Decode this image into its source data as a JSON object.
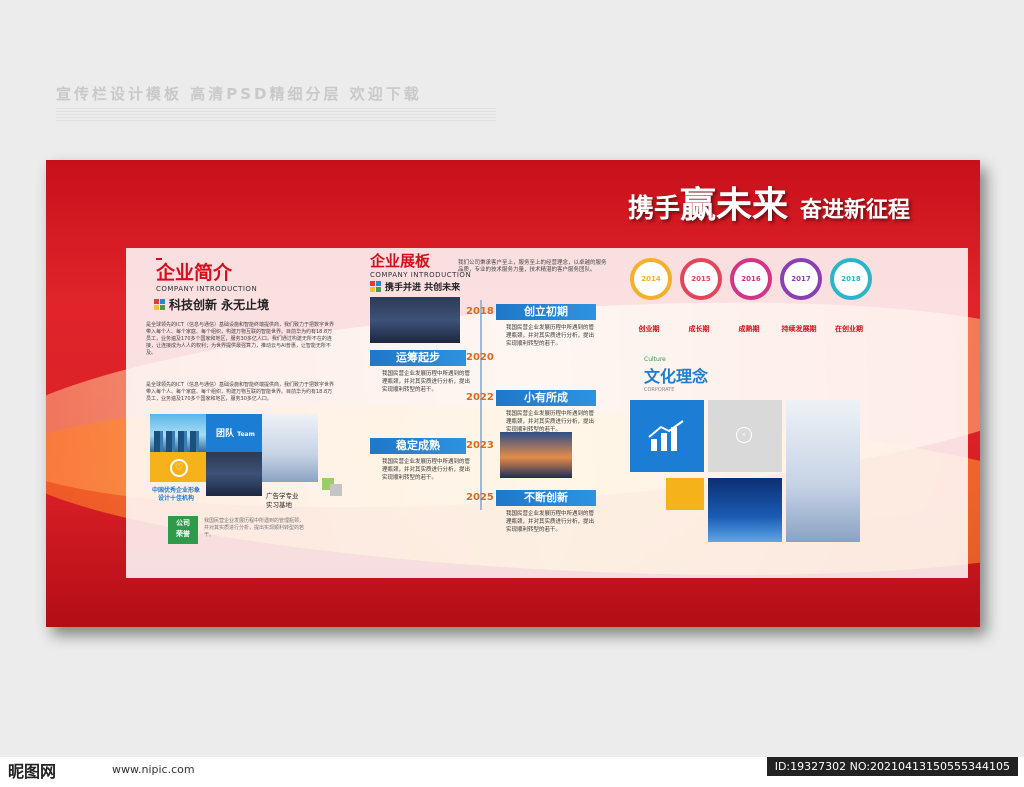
{
  "header": {
    "banner_text": "宣传栏设计模板 高清PSD精细分层 欢迎下载"
  },
  "board": {
    "slogan_part1": "携手",
    "slogan_part2": "赢未来",
    "slogan_part3": "奋进新征程"
  },
  "intro": {
    "title": "企业简介",
    "subtitle": "COMPANY INTRODUCTION",
    "tagline": "科技创新 永无止境",
    "paragraph1": "是全球领先的ICT（信息与通信）基础设施和智能终端提供商，我们致力于把数字世界带入每个人、每个家庭、每个组织，构建万物互联的智能世界。目前华为约有18.8万员工，业务遍及170多个国家和地区，服务30多亿人口。我们通过构建无所不在的连接，让连接成为人人的权利；为世界提供最强算力，推动云与AI普惠，让智能无所不及。",
    "paragraph2": "是全球领先的ICT（信息与通信）基础设施和智能终端提供商，我们致力于把数字世界带入每个人、每个家庭、每个组织，构建万物互联的智能世界。目前华为约有18.8万员工，业务遍及170多个国家和地区，服务30多亿人口。",
    "team_label": "团队",
    "team_sub": "Team",
    "honor_label1": "中国优秀企业形象",
    "honor_label2": "设计十佳机构",
    "base_label1": "广告学专业",
    "base_label2": "实习基地",
    "honor_badge1": "公司",
    "honor_badge2": "荣誉",
    "honor_text": "我国民营企业发展历程中所遇到的管理瓶颈，并对其实质进行分析，提出实现顺利转型的若干。"
  },
  "exhibit": {
    "title": "企业展板",
    "subtitle": "COMPANY INTRODUCTION",
    "tagline": "携手并进 共创未来",
    "intro_text": "我们公司秉承客户至上，服务至上的经营理念，以卓越的服务品质，专业的技术服务力量，技术精湛的客户服务团队。"
  },
  "timeline": {
    "items": [
      {
        "year": "2018",
        "label": "创立初期",
        "text": "我国民营企业发展历程中所遇到的管理瓶颈，并对其实质进行分析，提出实现顺利转型的若干。"
      },
      {
        "year": "2020",
        "label": "运筹起步",
        "text": "我国民营企业发展历程中所遇到的管理瓶颈，并对其实质进行分析，提出实现顺利转型的若干。"
      },
      {
        "year": "2022",
        "label": "小有所成",
        "text": "我国民营企业发展历程中所遇到的管理瓶颈，并对其实质进行分析，提出实现顺利转型的若干。"
      },
      {
        "year": "2023",
        "label": "稳定成熟",
        "text": "我国民营企业发展历程中所遇到的管理瓶颈，并对其实质进行分析，提出实现顺利转型的若干。"
      },
      {
        "year": "2025",
        "label": "不断创新",
        "text": "我国民营企业发展历程中所遇到的管理瓶颈，并对其实质进行分析，提出实现顺利转型的若干。"
      }
    ]
  },
  "stages": {
    "items": [
      {
        "year": "2014",
        "label": "创业期",
        "color": "#f5b02b"
      },
      {
        "year": "2015",
        "label": "成长期",
        "color": "#e5455a"
      },
      {
        "year": "2016",
        "label": "成熟期",
        "color": "#d63384"
      },
      {
        "year": "2017",
        "label": "持续发展期",
        "color": "#8a3fb5"
      },
      {
        "year": "2018",
        "label": "在创业期",
        "color": "#2bb5c8"
      }
    ]
  },
  "culture": {
    "title": "文化理念",
    "en_top": "Culture",
    "en_bottom": "CORPORATE"
  },
  "footer": {
    "site_logo": "昵图网",
    "site_url": "www.nipic.com",
    "image_id": "ID:19327302 NO:20210413150555344105"
  },
  "colors": {
    "board_red": "#d91f26",
    "accent_blue": "#1f77c8",
    "accent_orange": "#e06a1a"
  }
}
